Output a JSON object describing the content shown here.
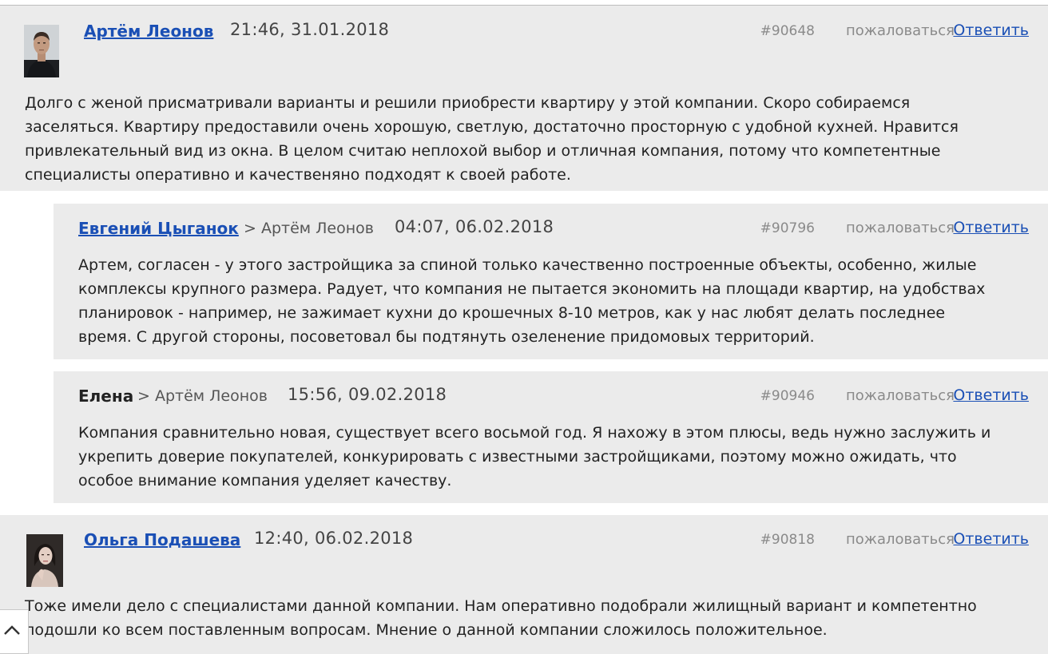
{
  "comments": [
    {
      "author": "Артём Леонов",
      "date": "21:46, 31.01.2018",
      "id": "#90648",
      "complain": "пожаловаться",
      "reply": "Ответить",
      "lines": [
        "Долго с женой присматривали варианты и решили приобрести квартиру у этой компании. Скоро собираемся",
        "заселяться. Квартиру предоставили очень хорошую, светлую, достаточно просторную с удобной кухней. Нравится",
        "привлекательный вид из окна. В целом считаю неплохой выбор и отличная компания, потому что компетентные",
        "специалисты оперативно и качественяно подходят к своей работе."
      ]
    },
    {
      "author": "Евгений Цыганок",
      "reply_to": "> Артём Леонов",
      "date": "04:07, 06.02.2018",
      "id": "#90796",
      "complain": "пожаловаться",
      "reply": "Ответить",
      "lines": [
        "Артем, согласен - у этого застройщика за спиной только качественно построенные объекты, особенно, жилые",
        "комплексы крупного размера. Радует, что компания не пытается экономить на площади квартир, на удобствах",
        "планировок - например, не зажимает кухни до крошечных 8-10 метров, как у нас любят делать последнее",
        "время. С другой стороны, посоветовал бы подтянуть озеленение придомовых территорий."
      ]
    },
    {
      "author": "Елена",
      "reply_to": "> Артём Леонов",
      "date": "15:56, 09.02.2018",
      "id": "#90946",
      "complain": "пожаловаться",
      "reply": "Ответить",
      "lines": [
        "Компания сравнительно новая, существует всего восьмой год. Я нахожу в этом плюсы, ведь нужно заслужить и",
        "укрепить доверие покупателей, конкурировать с известными застройщиками, поэтому можно ожидать, что",
        "особое внимание компания уделяет качеству."
      ]
    },
    {
      "author": "Ольга Подашева",
      "date": "12:40, 06.02.2018",
      "id": "#90818",
      "complain": "пожаловаться",
      "reply": "Ответить",
      "lines": [
        "Тоже имели дело с специалистами данной компании. Нам оперативно подобрали жилищный вариант и компетентно",
        "подошли ко всем поставленным вопросам. Мнение о данной компании сложилось положительное."
      ]
    }
  ],
  "scroll_button": {
    "icon": "chevron-up-icon"
  },
  "colors": {
    "comment_bg": "#ebebeb",
    "link": "#1a4fb5",
    "muted": "#8a8a8a"
  }
}
